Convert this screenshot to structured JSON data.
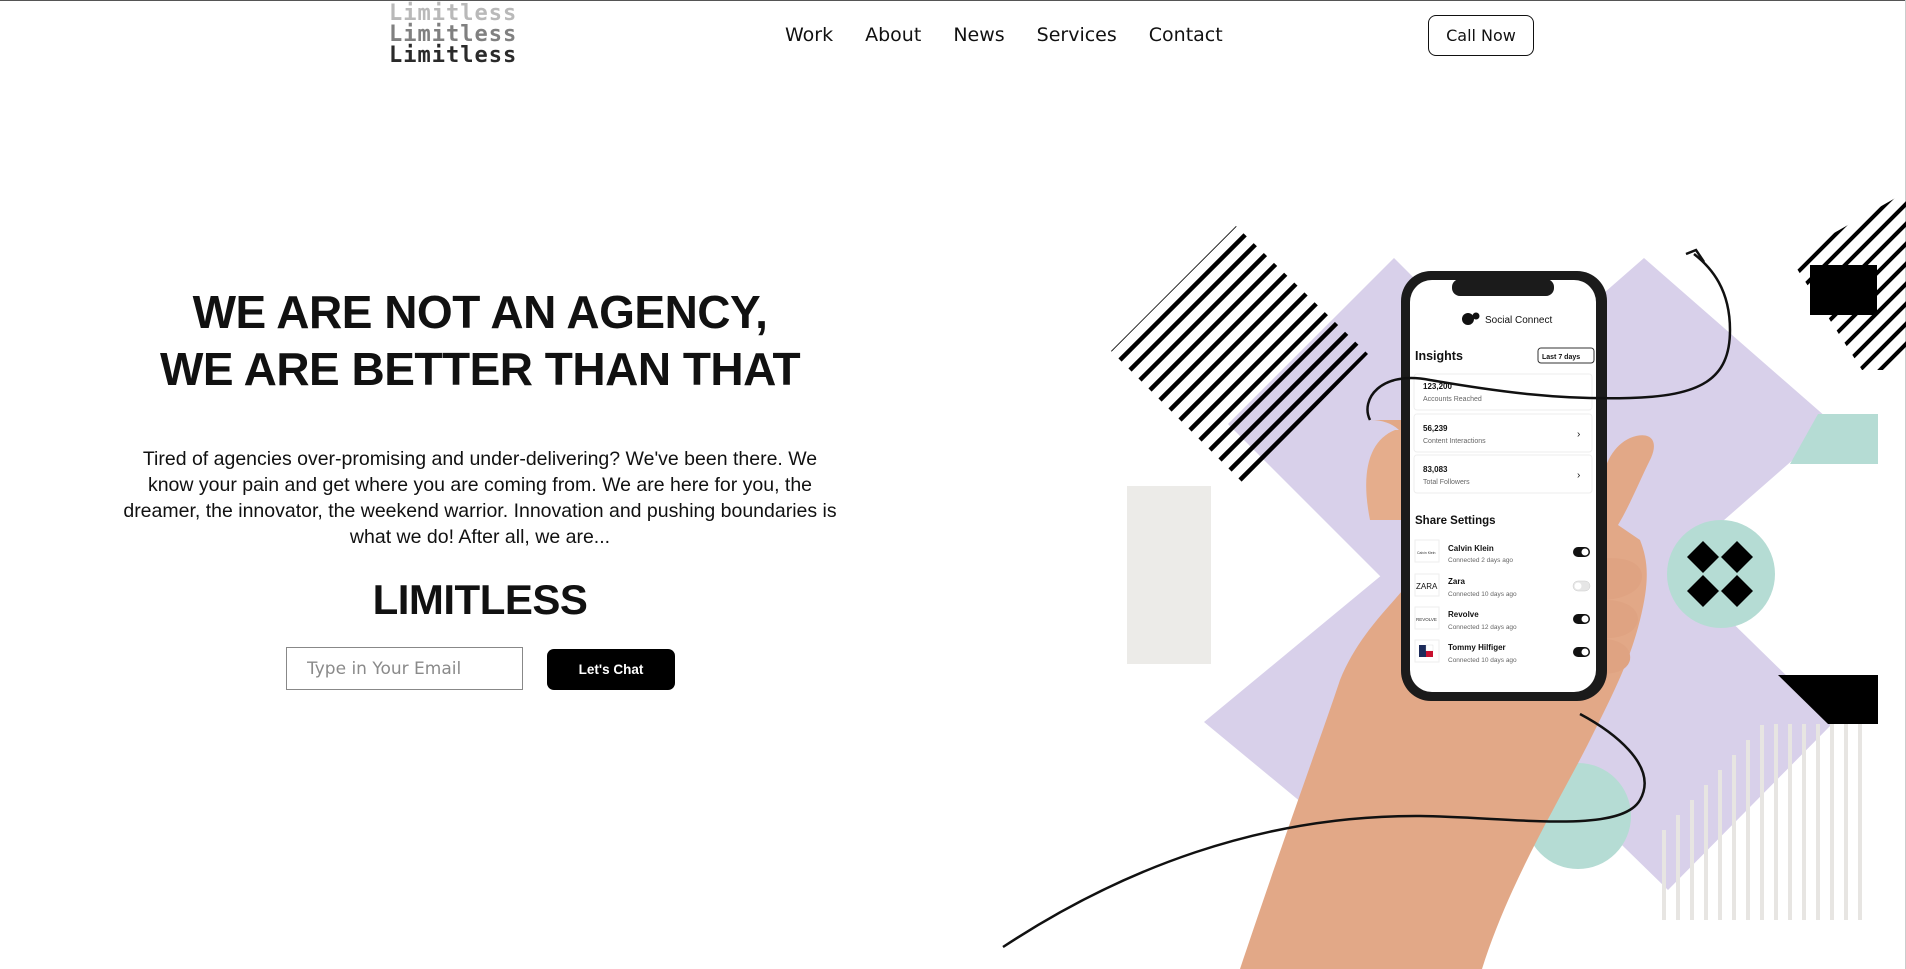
{
  "header": {
    "logo_lines": [
      "Limitless",
      "Limitless",
      "Limitless"
    ],
    "nav": [
      "Work",
      "About",
      "News",
      "Services",
      "Contact"
    ],
    "cta": "Call Now"
  },
  "hero": {
    "headline_line1": "WE ARE NOT AN AGENCY,",
    "headline_line2": "WE ARE BETTER THAN THAT",
    "paragraph": "Tired of agencies over-promising and under-delivering? We've been there. We know your pain and get where you are coming from. We are here for you, the dreamer, the innovator, the weekend warrior. Innovation and pushing boundaries is what we do! After all, we are...",
    "brand_word": "LIMITLESS",
    "email_placeholder": "Type in Your Email",
    "chat_button": "Let's Chat"
  },
  "phone": {
    "app_name": "Social Connect",
    "insights_title": "Insights",
    "range_select": "Last 7 days",
    "stats": [
      {
        "value": "123,200",
        "label": "Accounts Reached"
      },
      {
        "value": "56,239",
        "label": "Content Interactions"
      },
      {
        "value": "83,083",
        "label": "Total Followers"
      }
    ],
    "share_title": "Share Settings",
    "connections": [
      {
        "name": "Calvin Klein",
        "status": "Connected 2 days ago",
        "logo": "Calvin Klein",
        "on": true
      },
      {
        "name": "Zara",
        "status": "Connected 10 days ago",
        "logo": "ZARA",
        "on": false
      },
      {
        "name": "Revolve",
        "status": "Connected 12 days ago",
        "logo": "REVOLVE",
        "on": true
      },
      {
        "name": "Tommy Hilfiger",
        "status": "Connected 10 days ago",
        "logo": "flag",
        "on": true
      }
    ]
  },
  "colors": {
    "lavender": "#d8d0ea",
    "mint": "#b5dcd4",
    "beige": "#ecebe8",
    "black": "#000000",
    "skin": "#e2a887"
  }
}
